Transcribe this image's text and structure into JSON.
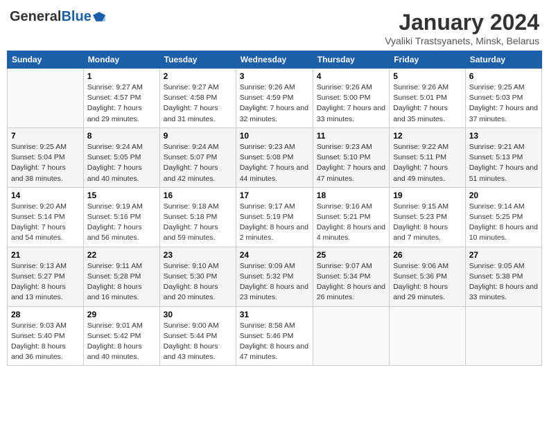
{
  "header": {
    "logo_general": "General",
    "logo_blue": "Blue",
    "month_year": "January 2024",
    "location": "Vyaliki Trastsyanets, Minsk, Belarus"
  },
  "days_of_week": [
    "Sunday",
    "Monday",
    "Tuesday",
    "Wednesday",
    "Thursday",
    "Friday",
    "Saturday"
  ],
  "weeks": [
    [
      {
        "day": "",
        "sunrise": "",
        "sunset": "",
        "daylight": ""
      },
      {
        "day": "1",
        "sunrise": "Sunrise: 9:27 AM",
        "sunset": "Sunset: 4:57 PM",
        "daylight": "Daylight: 7 hours and 29 minutes."
      },
      {
        "day": "2",
        "sunrise": "Sunrise: 9:27 AM",
        "sunset": "Sunset: 4:58 PM",
        "daylight": "Daylight: 7 hours and 31 minutes."
      },
      {
        "day": "3",
        "sunrise": "Sunrise: 9:26 AM",
        "sunset": "Sunset: 4:59 PM",
        "daylight": "Daylight: 7 hours and 32 minutes."
      },
      {
        "day": "4",
        "sunrise": "Sunrise: 9:26 AM",
        "sunset": "Sunset: 5:00 PM",
        "daylight": "Daylight: 7 hours and 33 minutes."
      },
      {
        "day": "5",
        "sunrise": "Sunrise: 9:26 AM",
        "sunset": "Sunset: 5:01 PM",
        "daylight": "Daylight: 7 hours and 35 minutes."
      },
      {
        "day": "6",
        "sunrise": "Sunrise: 9:25 AM",
        "sunset": "Sunset: 5:03 PM",
        "daylight": "Daylight: 7 hours and 37 minutes."
      }
    ],
    [
      {
        "day": "7",
        "sunrise": "Sunrise: 9:25 AM",
        "sunset": "Sunset: 5:04 PM",
        "daylight": "Daylight: 7 hours and 38 minutes."
      },
      {
        "day": "8",
        "sunrise": "Sunrise: 9:24 AM",
        "sunset": "Sunset: 5:05 PM",
        "daylight": "Daylight: 7 hours and 40 minutes."
      },
      {
        "day": "9",
        "sunrise": "Sunrise: 9:24 AM",
        "sunset": "Sunset: 5:07 PM",
        "daylight": "Daylight: 7 hours and 42 minutes."
      },
      {
        "day": "10",
        "sunrise": "Sunrise: 9:23 AM",
        "sunset": "Sunset: 5:08 PM",
        "daylight": "Daylight: 7 hours and 44 minutes."
      },
      {
        "day": "11",
        "sunrise": "Sunrise: 9:23 AM",
        "sunset": "Sunset: 5:10 PM",
        "daylight": "Daylight: 7 hours and 47 minutes."
      },
      {
        "day": "12",
        "sunrise": "Sunrise: 9:22 AM",
        "sunset": "Sunset: 5:11 PM",
        "daylight": "Daylight: 7 hours and 49 minutes."
      },
      {
        "day": "13",
        "sunrise": "Sunrise: 9:21 AM",
        "sunset": "Sunset: 5:13 PM",
        "daylight": "Daylight: 7 hours and 51 minutes."
      }
    ],
    [
      {
        "day": "14",
        "sunrise": "Sunrise: 9:20 AM",
        "sunset": "Sunset: 5:14 PM",
        "daylight": "Daylight: 7 hours and 54 minutes."
      },
      {
        "day": "15",
        "sunrise": "Sunrise: 9:19 AM",
        "sunset": "Sunset: 5:16 PM",
        "daylight": "Daylight: 7 hours and 56 minutes."
      },
      {
        "day": "16",
        "sunrise": "Sunrise: 9:18 AM",
        "sunset": "Sunset: 5:18 PM",
        "daylight": "Daylight: 7 hours and 59 minutes."
      },
      {
        "day": "17",
        "sunrise": "Sunrise: 9:17 AM",
        "sunset": "Sunset: 5:19 PM",
        "daylight": "Daylight: 8 hours and 2 minutes."
      },
      {
        "day": "18",
        "sunrise": "Sunrise: 9:16 AM",
        "sunset": "Sunset: 5:21 PM",
        "daylight": "Daylight: 8 hours and 4 minutes."
      },
      {
        "day": "19",
        "sunrise": "Sunrise: 9:15 AM",
        "sunset": "Sunset: 5:23 PM",
        "daylight": "Daylight: 8 hours and 7 minutes."
      },
      {
        "day": "20",
        "sunrise": "Sunrise: 9:14 AM",
        "sunset": "Sunset: 5:25 PM",
        "daylight": "Daylight: 8 hours and 10 minutes."
      }
    ],
    [
      {
        "day": "21",
        "sunrise": "Sunrise: 9:13 AM",
        "sunset": "Sunset: 5:27 PM",
        "daylight": "Daylight: 8 hours and 13 minutes."
      },
      {
        "day": "22",
        "sunrise": "Sunrise: 9:11 AM",
        "sunset": "Sunset: 5:28 PM",
        "daylight": "Daylight: 8 hours and 16 minutes."
      },
      {
        "day": "23",
        "sunrise": "Sunrise: 9:10 AM",
        "sunset": "Sunset: 5:30 PM",
        "daylight": "Daylight: 8 hours and 20 minutes."
      },
      {
        "day": "24",
        "sunrise": "Sunrise: 9:09 AM",
        "sunset": "Sunset: 5:32 PM",
        "daylight": "Daylight: 8 hours and 23 minutes."
      },
      {
        "day": "25",
        "sunrise": "Sunrise: 9:07 AM",
        "sunset": "Sunset: 5:34 PM",
        "daylight": "Daylight: 8 hours and 26 minutes."
      },
      {
        "day": "26",
        "sunrise": "Sunrise: 9:06 AM",
        "sunset": "Sunset: 5:36 PM",
        "daylight": "Daylight: 8 hours and 29 minutes."
      },
      {
        "day": "27",
        "sunrise": "Sunrise: 9:05 AM",
        "sunset": "Sunset: 5:38 PM",
        "daylight": "Daylight: 8 hours and 33 minutes."
      }
    ],
    [
      {
        "day": "28",
        "sunrise": "Sunrise: 9:03 AM",
        "sunset": "Sunset: 5:40 PM",
        "daylight": "Daylight: 8 hours and 36 minutes."
      },
      {
        "day": "29",
        "sunrise": "Sunrise: 9:01 AM",
        "sunset": "Sunset: 5:42 PM",
        "daylight": "Daylight: 8 hours and 40 minutes."
      },
      {
        "day": "30",
        "sunrise": "Sunrise: 9:00 AM",
        "sunset": "Sunset: 5:44 PM",
        "daylight": "Daylight: 8 hours and 43 minutes."
      },
      {
        "day": "31",
        "sunrise": "Sunrise: 8:58 AM",
        "sunset": "Sunset: 5:46 PM",
        "daylight": "Daylight: 8 hours and 47 minutes."
      },
      {
        "day": "",
        "sunrise": "",
        "sunset": "",
        "daylight": ""
      },
      {
        "day": "",
        "sunrise": "",
        "sunset": "",
        "daylight": ""
      },
      {
        "day": "",
        "sunrise": "",
        "sunset": "",
        "daylight": ""
      }
    ]
  ]
}
